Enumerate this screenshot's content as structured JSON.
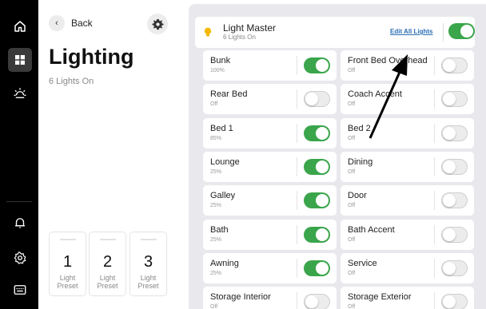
{
  "nav": {
    "items": [
      {
        "icon": "home-icon"
      },
      {
        "icon": "lighting-grid-icon",
        "active": true
      },
      {
        "icon": "sun-icon"
      },
      {
        "icon": "bell-icon"
      },
      {
        "icon": "settings-icon"
      },
      {
        "icon": "keyboard-icon"
      }
    ]
  },
  "side": {
    "back_label": "Back",
    "title": "Lighting",
    "subtitle": "6 Lights On",
    "presets": [
      {
        "number": "1",
        "label_line1": "Light",
        "label_line2": "Preset"
      },
      {
        "number": "2",
        "label_line1": "Light",
        "label_line2": "Preset"
      },
      {
        "number": "3",
        "label_line1": "Light",
        "label_line2": "Preset"
      }
    ]
  },
  "master": {
    "name": "Light Master",
    "status": "6 Lights On",
    "edit_label": "Edit All Lights",
    "on": true
  },
  "lights": [
    {
      "name": "Bunk",
      "status": "100%",
      "on": true
    },
    {
      "name": "Front Bed Overhead",
      "status": "Off",
      "on": false
    },
    {
      "name": "Rear Bed",
      "status": "Off",
      "on": false
    },
    {
      "name": "Coach Accent",
      "status": "Off",
      "on": false
    },
    {
      "name": "Bed 1",
      "status": "85%",
      "on": true
    },
    {
      "name": "Bed 2",
      "status": "Off",
      "on": false
    },
    {
      "name": "Lounge",
      "status": "25%",
      "on": true
    },
    {
      "name": "Dining",
      "status": "Off",
      "on": false
    },
    {
      "name": "Galley",
      "status": "25%",
      "on": true
    },
    {
      "name": "Door",
      "status": "Off",
      "on": false
    },
    {
      "name": "Bath",
      "status": "25%",
      "on": true
    },
    {
      "name": "Bath Accent",
      "status": "Off",
      "on": false
    },
    {
      "name": "Awning",
      "status": "25%",
      "on": true
    },
    {
      "name": "Service",
      "status": "Off",
      "on": false
    },
    {
      "name": "Storage Interior",
      "status": "Off",
      "on": false
    },
    {
      "name": "Storage Exterior",
      "status": "Off",
      "on": false
    }
  ],
  "colors": {
    "accent_green": "#3aa54b",
    "bulb_yellow": "#f5b800",
    "link_blue": "#2a6db5"
  }
}
